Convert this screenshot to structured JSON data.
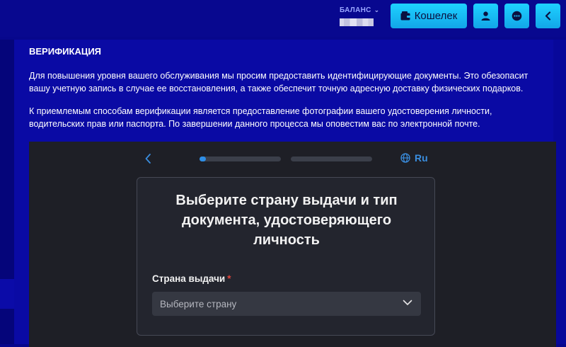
{
  "header": {
    "balance_label": "БАЛАНС",
    "wallet_label": "Кошелек"
  },
  "page": {
    "title": "ВЕРИФИКАЦИЯ",
    "paragraph1": "Для повышения уровня вашего обслуживания мы просим предоставить идентифицирующие документы. Это обезопасит вашу учетную запись в случае ее восстановления, а также обеспечит точную адресную доставку физических подарков.",
    "paragraph2": "К приемлемым способам верификации является предоставление фотографии вашего удостоверения личности, водительских прав или паспорта. По завершении данного процесса мы оповестим вас по электронной почте."
  },
  "widget": {
    "language": "Ru",
    "progress": [
      0.08,
      0
    ],
    "card_title": "Выберите страну выдачи и тип документа, удостоверяющего личность",
    "country_label": "Страна выдачи",
    "required_mark": "*",
    "country_placeholder": "Выберите страну"
  },
  "colors": {
    "background": "#07078c",
    "accent_button": "#1ed1ff",
    "widget_bg": "#1e1f26",
    "widget_accent": "#2e8ee6",
    "required": "#e0443a"
  },
  "icons": {
    "wallet": "wallet-icon",
    "user": "user-icon",
    "chat": "chat-icon",
    "back": "chevron-left-icon",
    "language": "globe-icon",
    "select": "chevron-down-icon"
  }
}
